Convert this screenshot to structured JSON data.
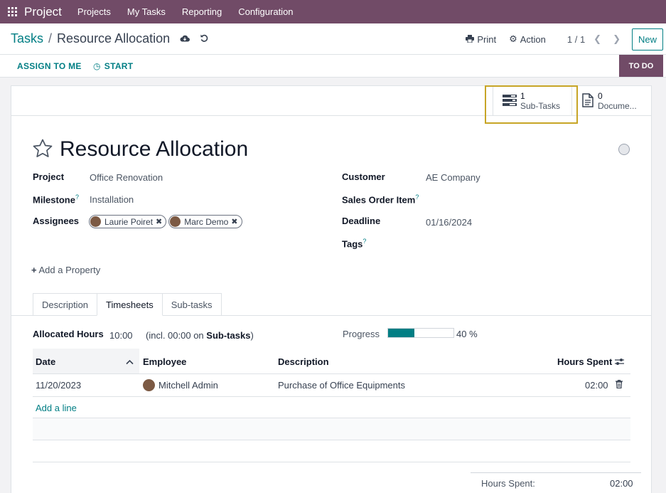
{
  "topnav": {
    "app_name": "Project",
    "menus": [
      "Projects",
      "My Tasks",
      "Reporting",
      "Configuration"
    ]
  },
  "control_panel": {
    "breadcrumb_parent": "Tasks",
    "breadcrumb_separator": "/",
    "breadcrumb_current": "Resource Allocation",
    "print_label": "Print",
    "action_label": "Action",
    "pager": "1 / 1",
    "new_label": "New"
  },
  "statusbar": {
    "assign_label": "ASSIGN TO ME",
    "start_label": "START",
    "stage": "TO DO"
  },
  "smart_buttons": {
    "subtasks_count": "1",
    "subtasks_label": "Sub-Tasks",
    "documents_count": "0",
    "documents_label": "Docume..."
  },
  "record": {
    "title": "Resource Allocation",
    "fields_left": {
      "project_label": "Project",
      "project_value": "Office Renovation",
      "milestone_label": "Milestone",
      "milestone_value": "Installation",
      "assignees_label": "Assignees",
      "assignees": [
        "Laurie Poiret",
        "Marc Demo"
      ]
    },
    "fields_right": {
      "customer_label": "Customer",
      "customer_value": "AE Company",
      "sales_order_label": "Sales Order Item",
      "deadline_label": "Deadline",
      "deadline_value": "01/16/2024",
      "tags_label": "Tags"
    },
    "help_mark": "?",
    "add_property": "Add a Property"
  },
  "tabs": [
    "Description",
    "Timesheets",
    "Sub-tasks"
  ],
  "timesheets": {
    "allocated_label": "Allocated Hours",
    "allocated_value": "10:00",
    "incl_prefix": "(incl. 00:00 on",
    "incl_subtasks": "Sub-tasks",
    "incl_suffix": ")",
    "progress_label": "Progress",
    "progress_percent": 40,
    "progress_text": "40 %",
    "columns": [
      "Date",
      "Employee",
      "Description",
      "Hours Spent"
    ],
    "rows": [
      {
        "date": "11/20/2023",
        "employee": "Mitchell Admin",
        "description": "Purchase of Office Equipments",
        "hours": "02:00"
      }
    ],
    "add_line": "Add a line",
    "total_label": "Hours Spent:",
    "total_value": "02:00"
  },
  "colors": {
    "brand": "#714b67",
    "accent": "#017e84",
    "highlight": "#c7a526"
  }
}
